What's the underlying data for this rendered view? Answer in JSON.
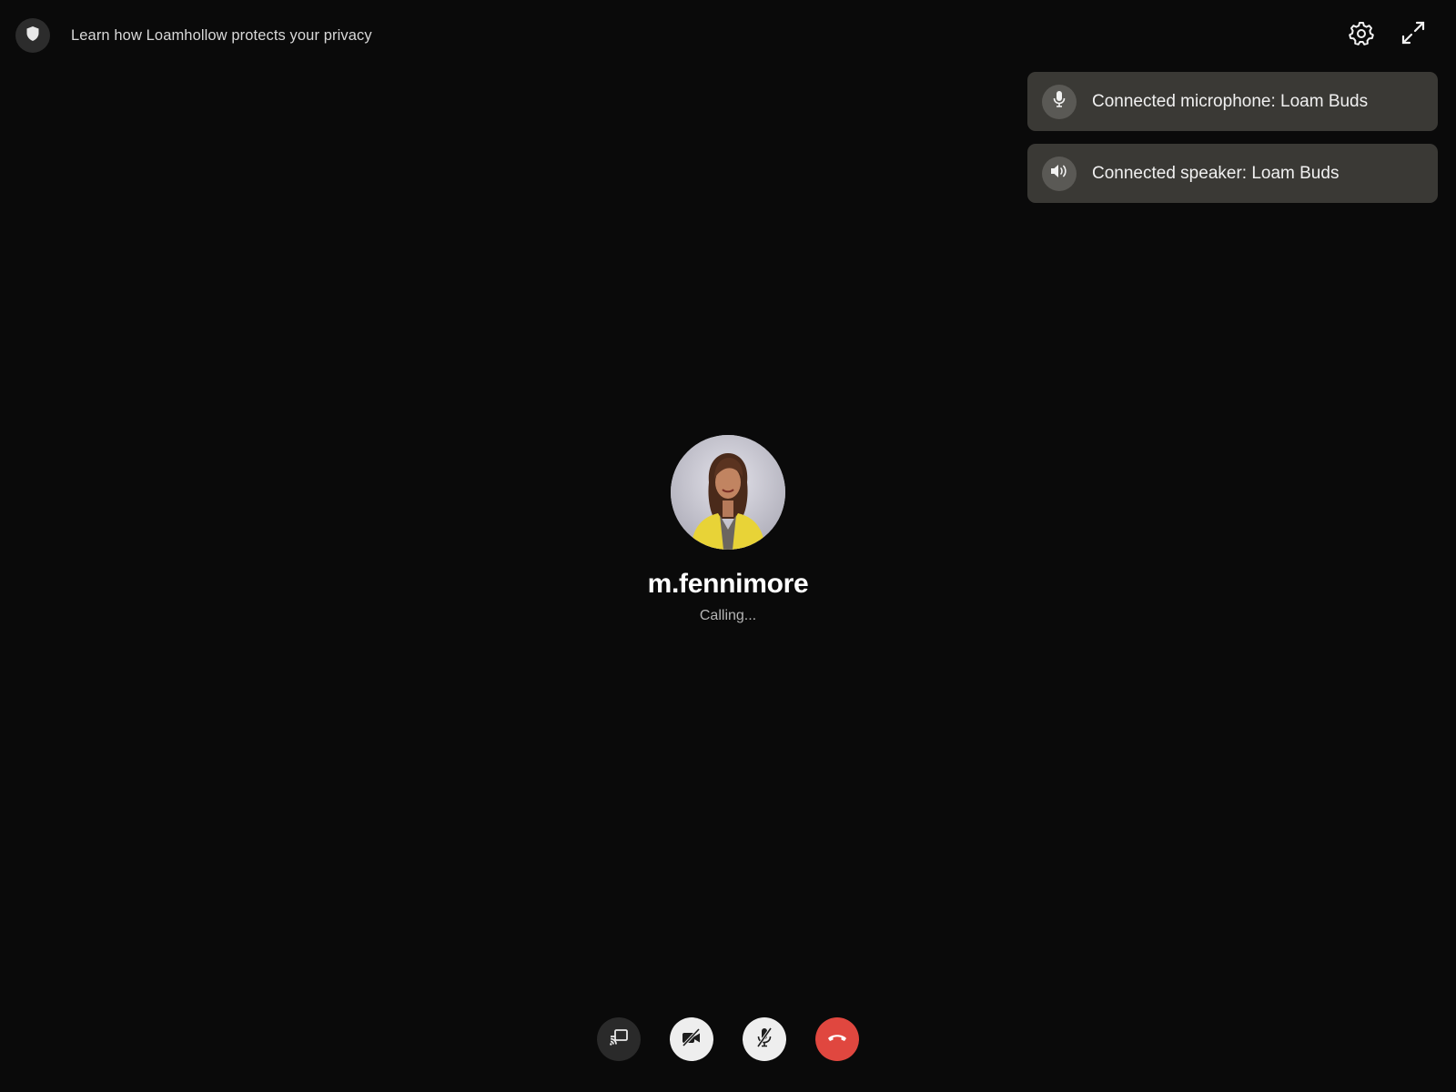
{
  "privacy": {
    "text": "Learn how Loamhollow protects your privacy",
    "icon": "shield-icon"
  },
  "top_actions": {
    "settings_icon": "gear-icon",
    "fullscreen_icon": "expand-icon"
  },
  "toasts": [
    {
      "icon": "microphone-icon",
      "text": "Connected microphone: Loam Buds"
    },
    {
      "icon": "speaker-icon",
      "text": "Connected speaker: Loam Buds"
    }
  ],
  "callee": {
    "name": "m.fennimore",
    "status": "Calling..."
  },
  "controls": [
    {
      "name": "share-screen",
      "icon": "screen-share-icon"
    },
    {
      "name": "camera-off",
      "icon": "video-off-icon"
    },
    {
      "name": "microphone-muted",
      "icon": "mic-off-icon"
    },
    {
      "name": "end-call",
      "icon": "hang-up-icon"
    }
  ],
  "colors": {
    "background": "#0a0a0a",
    "toast_bg": "#3a3935",
    "end_call": "#e0473f",
    "control_light": "#eeeeee",
    "control_dark": "#2a2a2a"
  }
}
